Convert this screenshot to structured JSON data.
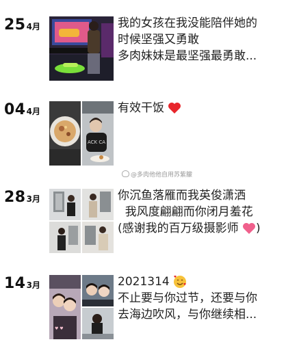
{
  "posts": [
    {
      "day": "25",
      "month": "4月",
      "lines": [
        "我的女孩在我没能陪伴她的",
        "时候坚强又勇敢",
        "多肉妹妹是最坚强最勇敢..."
      ],
      "images": [
        {
          "icon": "photo-arcade-racing-game"
        }
      ]
    },
    {
      "day": "04",
      "month": "4月",
      "lines": [
        "有效干饭"
      ],
      "emoji": "red-heart",
      "images": [
        {
          "icon": "photo-food-plate"
        },
        {
          "icon": "photo-person-dining"
        }
      ]
    },
    {
      "day": "28",
      "month": "3月",
      "lines": [
        "你沉鱼落雁而我英俊潇洒",
        "  我风度翩翩而你闭月羞花",
        "(感谢我的百万级摄影师"
      ],
      "emoji_after_last": "pink-heart",
      "emoji_after_text": ")",
      "images": [
        {
          "icon": "photo-person-portrait"
        },
        {
          "icon": "photo-person-portrait"
        },
        {
          "icon": "photo-person-portrait"
        },
        {
          "icon": "photo-person-portrait"
        }
      ]
    },
    {
      "day": "14",
      "month": "3月",
      "lines": [
        "2021314",
        "不止要与你过节，还要与你",
        "去海边吹风，与你继续相..."
      ],
      "emoji_first_line": "smiling-face-with-hearts",
      "images": [
        {
          "icon": "photo-selfie-couple"
        },
        {
          "icon": "photo-selfie-couple"
        },
        {
          "icon": "photo-selfie-couple"
        }
      ]
    }
  ],
  "watermark": "@多肉他他自用苏紫朦",
  "colors": {
    "heart_red": "#e8262c",
    "heart_pink": "#f0608c"
  }
}
